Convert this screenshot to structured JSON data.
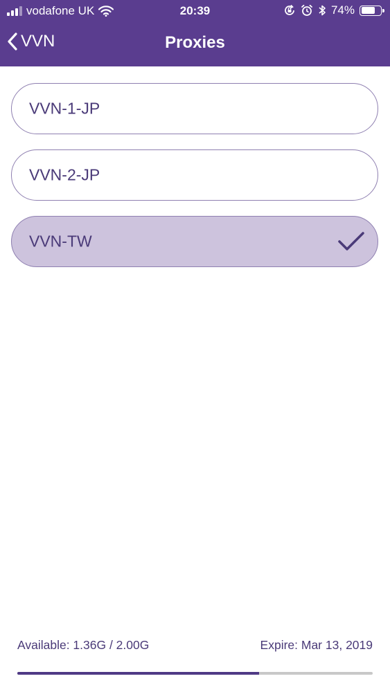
{
  "status_bar": {
    "carrier": "vodafone UK",
    "time": "20:39",
    "battery_percent_text": "74%",
    "battery_level": 0.74,
    "icons": [
      "signal-icon",
      "wifi-icon",
      "orientation-lock-icon",
      "alarm-icon",
      "bluetooth-icon",
      "battery-icon"
    ]
  },
  "nav": {
    "back_label": "VVN",
    "title": "Proxies"
  },
  "proxies": [
    {
      "name": "VVN-1-JP",
      "selected": false
    },
    {
      "name": "VVN-2-JP",
      "selected": false
    },
    {
      "name": "VVN-TW",
      "selected": true
    }
  ],
  "footer": {
    "available": "Available: 1.36G / 2.00G",
    "expire": "Expire: Mar 13, 2019",
    "usage_fraction": 0.68
  },
  "colors": {
    "header_bg": "#5a3d8f",
    "accent": "#4f3a85",
    "selected_bg": "#cdc3dd",
    "border": "#8e7fb0"
  }
}
